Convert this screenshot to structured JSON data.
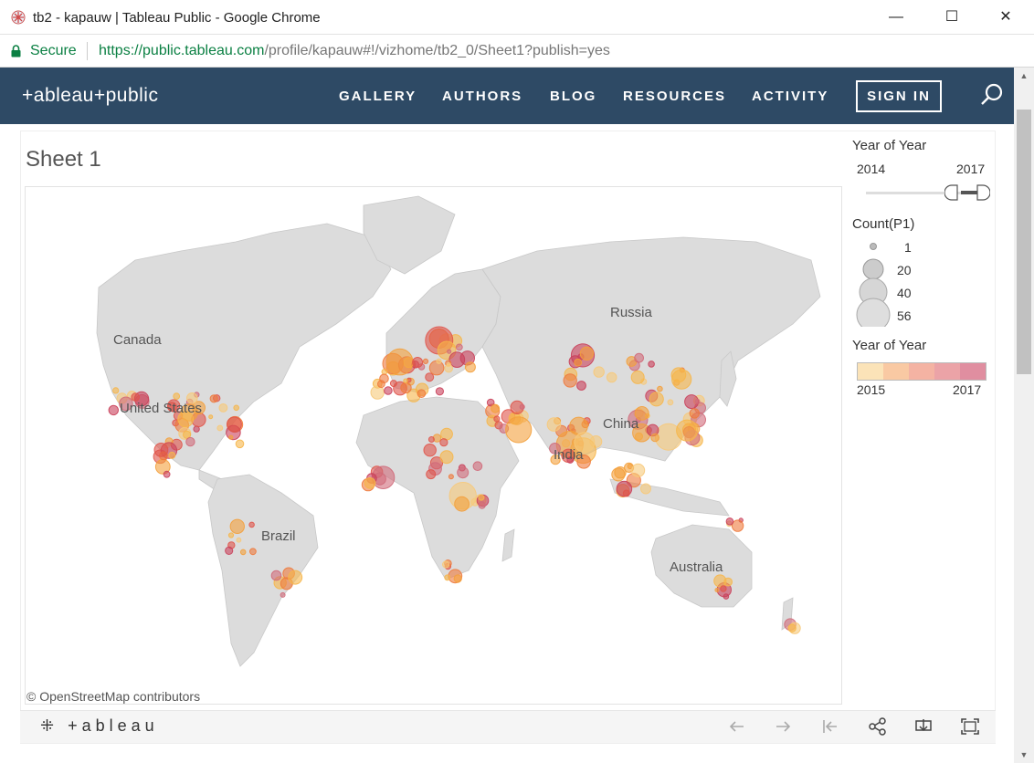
{
  "browser": {
    "tab_title": "tb2 - kapauw | Tableau Public - Google Chrome",
    "secure_label": "Secure",
    "url_proto": "https://",
    "url_host": "public.tableau.com",
    "url_path": "/profile/kapauw#!/vizhome/tb2_0/Sheet1?publish=yes",
    "minimize_glyph": "—",
    "maximize_glyph": "☐",
    "close_glyph": "✕"
  },
  "site_nav": {
    "logo": "+ableau+public",
    "items": [
      "GALLERY",
      "AUTHORS",
      "BLOG",
      "RESOURCES",
      "ACTIVITY"
    ],
    "sign_in": "SIGN IN"
  },
  "viz": {
    "sheet_title": "Sheet 1",
    "attribution": "© OpenStreetMap contributors",
    "map_labels": [
      "Canada",
      "United States",
      "Russia",
      "China",
      "India",
      "Brazil",
      "Australia"
    ]
  },
  "legend": {
    "year_filter_title": "Year of Year",
    "year_min": "2014",
    "year_max": "2017",
    "size_title": "Count(P1)",
    "size_values": [
      "1",
      "20",
      "40",
      "56"
    ],
    "color_title": "Year of Year",
    "color_min": "2015",
    "color_max": "2017",
    "color_stops": [
      "#fbe3b8",
      "#f9c9a3",
      "#f4b3a3",
      "#eba3a7",
      "#e08ea0"
    ]
  },
  "toolbar": {
    "logo": "+ableau"
  },
  "colors": {
    "nav_bg": "#2e4a65",
    "secure_green": "#0b8043",
    "land": "#dcdcdc",
    "ocean": "#ffffff"
  }
}
